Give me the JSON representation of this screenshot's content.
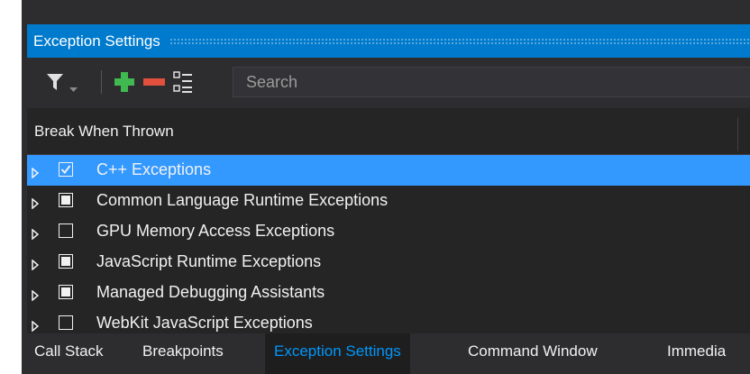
{
  "window": {
    "title": "Exception Settings",
    "accent_color": "#007acc",
    "selection_color": "#3399ff",
    "active_tab_color": "#0097fb"
  },
  "toolbar": {
    "filter_icon": "filter-icon",
    "dropdown_icon": "chevron-down-icon",
    "add_icon": "plus-icon",
    "remove_icon": "minus-icon",
    "list_icon": "restore-list-icon",
    "search_placeholder": "Search"
  },
  "grid": {
    "column_header": "Break When Thrown",
    "rows": [
      {
        "label": "C++ Exceptions",
        "state": "checked",
        "selected": true
      },
      {
        "label": "Common Language Runtime Exceptions",
        "state": "partial",
        "selected": false
      },
      {
        "label": "GPU Memory Access Exceptions",
        "state": "unchecked",
        "selected": false
      },
      {
        "label": "JavaScript Runtime Exceptions",
        "state": "partial",
        "selected": false
      },
      {
        "label": "Managed Debugging Assistants",
        "state": "partial",
        "selected": false
      },
      {
        "label": "WebKit JavaScript Exceptions",
        "state": "unchecked",
        "selected": false
      }
    ]
  },
  "bottom_tabs": [
    {
      "label": "Call Stack",
      "active": false
    },
    {
      "label": "Breakpoints",
      "active": false
    },
    {
      "label": "Exception Settings",
      "active": true
    },
    {
      "label": "Command Window",
      "active": false
    },
    {
      "label": "Immedia",
      "active": false
    }
  ]
}
